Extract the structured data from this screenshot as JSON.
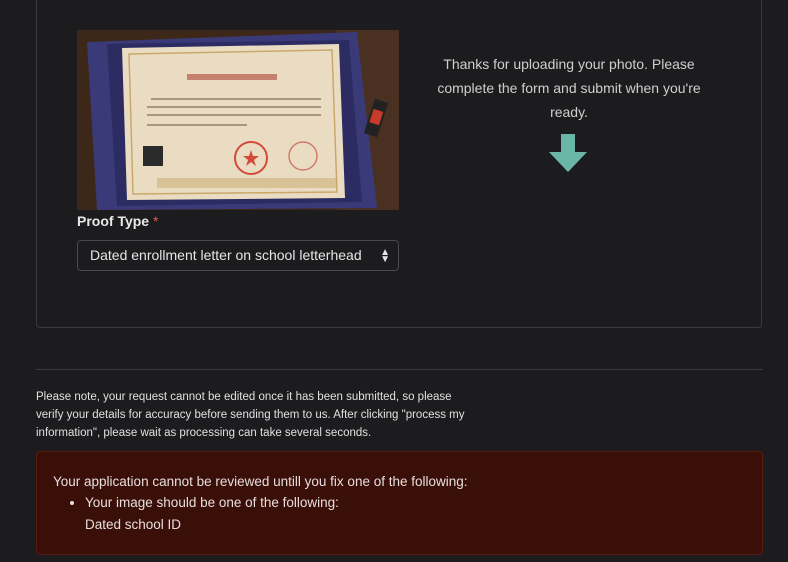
{
  "upload": {
    "thanks_message": "Thanks for uploading your photo. Please complete the form and submit when you're ready.",
    "photo_alt": "Uploaded proof document photo",
    "accent_color": "#6ab7a8"
  },
  "form": {
    "proof_type_label": "Proof Type",
    "required_marker": "*",
    "proof_type_selected": "Dated enrollment letter on school letterhead"
  },
  "notice": {
    "text": "Please note, your request cannot be edited once it has been submitted, so please verify your details for accuracy before sending them to us. After clicking \"process my information\", please wait as processing can take several seconds."
  },
  "alert": {
    "heading": "Your application cannot be reviewed untill you fix one of the following:",
    "items": [
      {
        "label": "Your image should be one of the following:",
        "detail": "Dated school ID"
      }
    ],
    "background_color": "#3a0f08"
  }
}
